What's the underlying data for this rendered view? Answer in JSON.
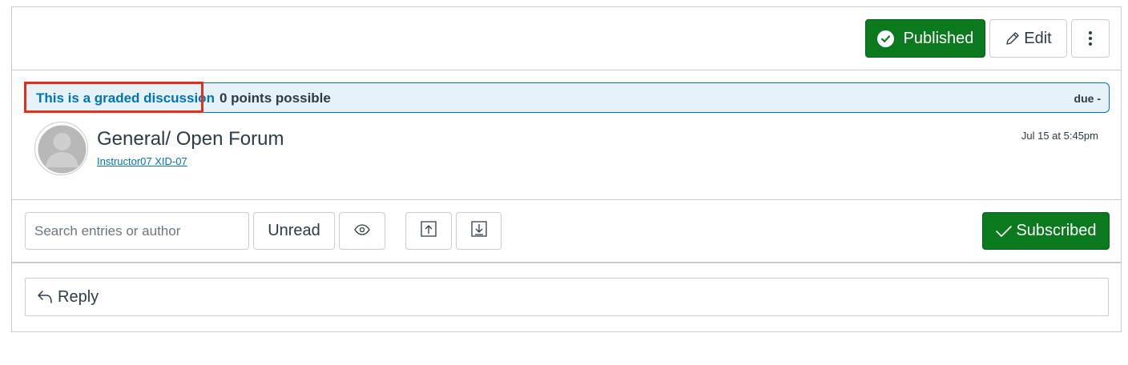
{
  "toolbar": {
    "published_label": "Published",
    "edit_label": "Edit"
  },
  "banner": {
    "graded_label": "This is a graded discussion",
    "points_label": "0 points possible",
    "due_label": "due -"
  },
  "topic": {
    "title": "General/ Open Forum",
    "author": "Instructor07 XID-07",
    "timestamp": "Jul 15 at 5:45pm"
  },
  "actions": {
    "search_placeholder": "Search entries or author",
    "unread_label": "Unread",
    "subscribed_label": "Subscribed"
  },
  "reply": {
    "label": "Reply"
  },
  "icons": {
    "published": "check-circle-icon",
    "edit": "pencil-icon",
    "more": "kebab-icon",
    "view": "eye-icon",
    "expand": "upload-icon",
    "collapse": "download-icon",
    "subscribed": "checkmark-icon",
    "reply": "reply-arrow-icon"
  },
  "colors": {
    "brand_green": "#0b7a1f",
    "link_blue": "#0374b5",
    "banner_bg": "#e5f2f8",
    "highlight": "#e2311a"
  }
}
